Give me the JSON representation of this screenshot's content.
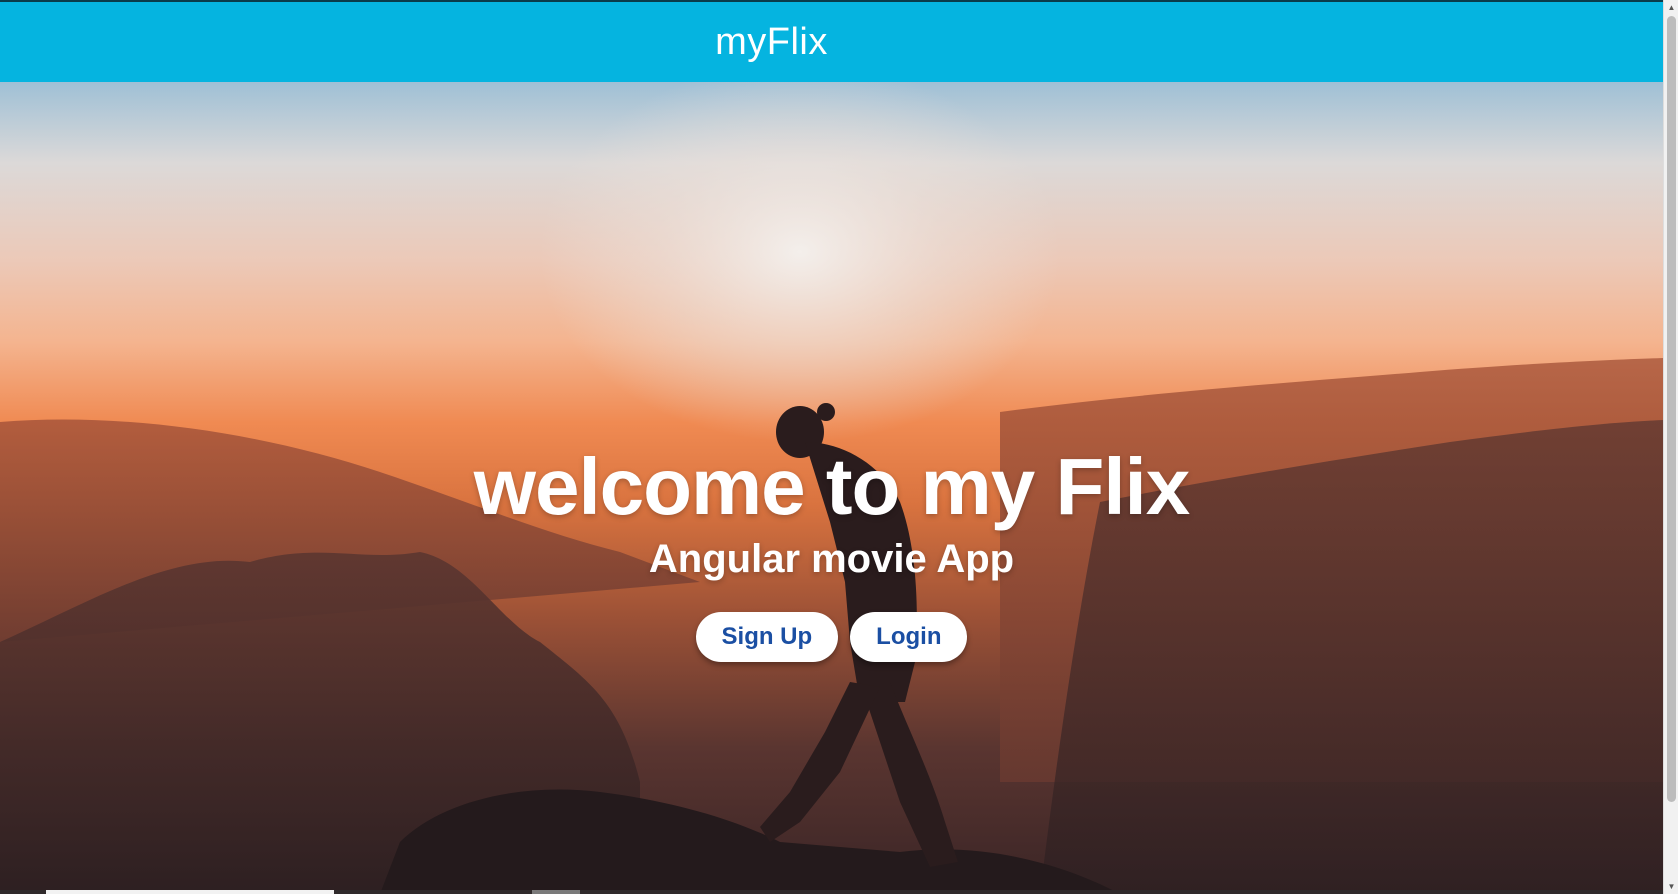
{
  "toolbar": {
    "title": "myFlix"
  },
  "hero": {
    "title": "welcome to my Flix",
    "subtitle": "Angular movie App"
  },
  "actions": {
    "signup_label": "Sign Up",
    "login_label": "Login"
  },
  "colors": {
    "toolbar_bg": "#05b4e0",
    "button_text": "#1b4fa3",
    "button_bg": "#ffffff"
  }
}
